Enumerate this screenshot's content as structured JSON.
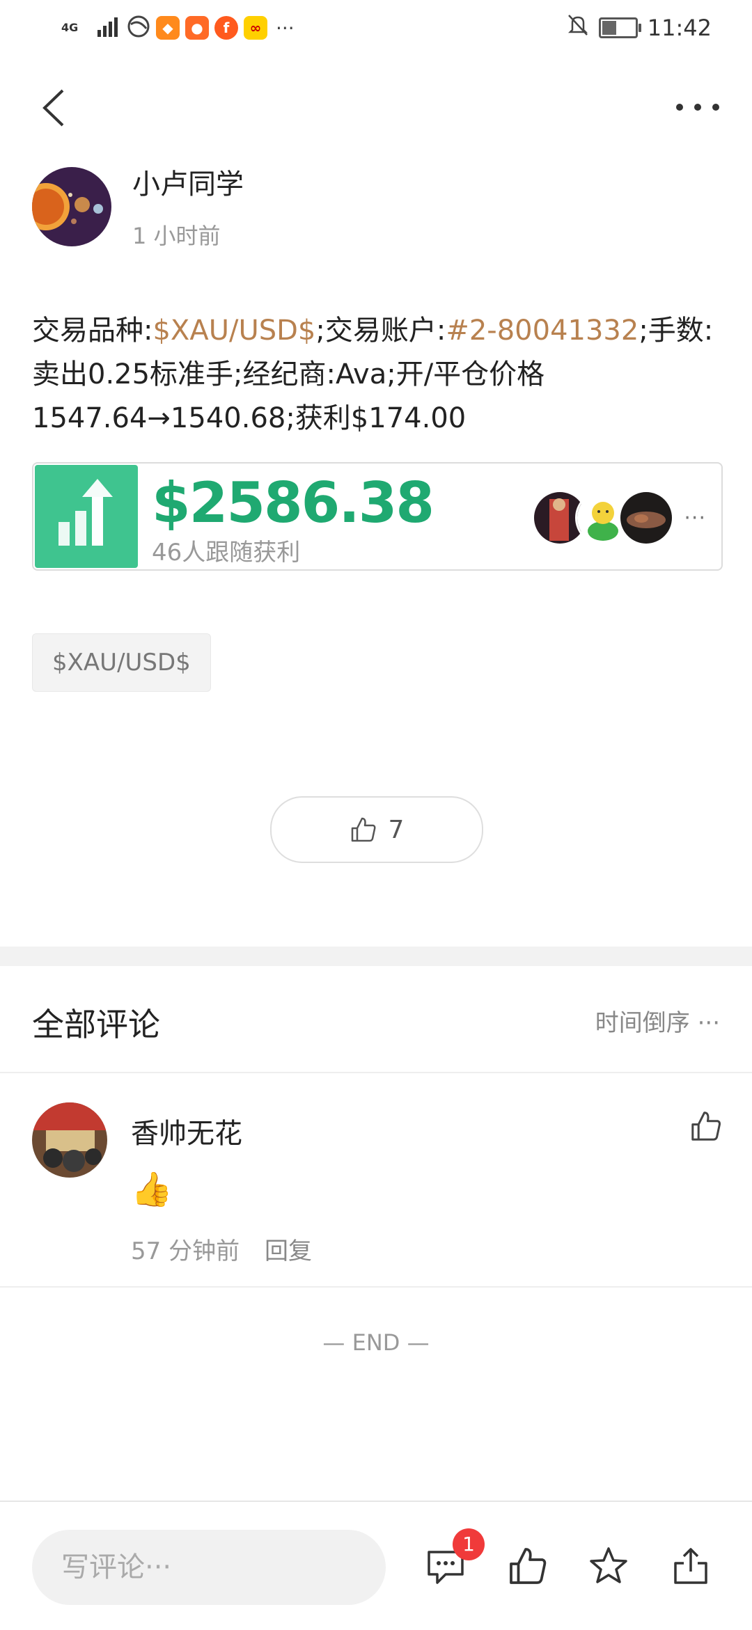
{
  "status_bar": {
    "signal": "4G",
    "time": "11:42"
  },
  "post": {
    "author": "小卢同学",
    "time": "1 小时前",
    "text_parts": {
      "p1": "交易品种:",
      "symbol": "$XAU/USD$",
      "p2": ";交易账户:",
      "account": "#2-80041332",
      "p3": ";手数:卖出0.25标准手;经纪商:Ava;开/平仓价格1547.64→1540.68;获利$174.00"
    },
    "profit": {
      "amount": "$2586.38",
      "followers_text": "46人跟随获利",
      "more": "···"
    },
    "tag": "$XAU/USD$",
    "like_count": "7"
  },
  "comments": {
    "title": "全部评论",
    "sort": "时间倒序 ···",
    "items": [
      {
        "name": "香帅无花",
        "content": "👍",
        "time": "57 分钟前",
        "reply": "回复"
      }
    ],
    "end": "— END —"
  },
  "bottom_bar": {
    "placeholder": "写评论···",
    "badge": "1"
  },
  "colors": {
    "accent_green": "#1fa971",
    "highlight": "#b8814f",
    "badge_red": "#f03a3a"
  }
}
